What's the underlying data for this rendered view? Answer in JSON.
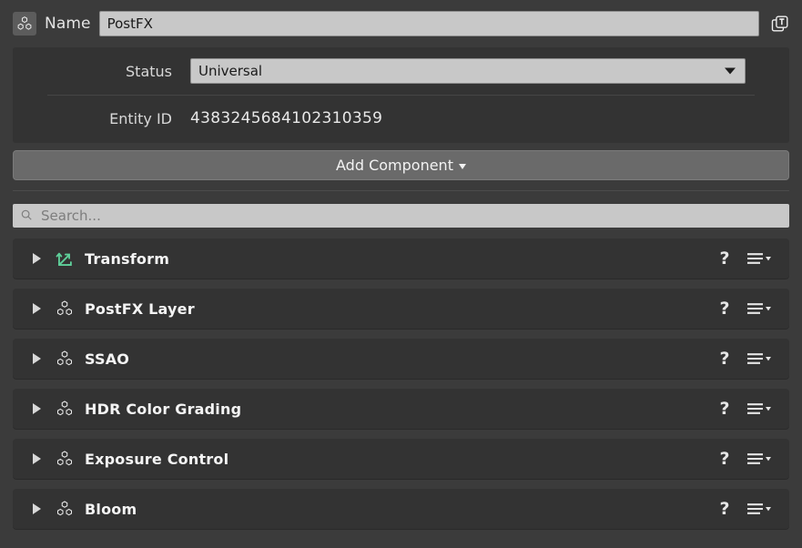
{
  "header": {
    "entity_icon": "cubes-icon",
    "name_label": "Name",
    "name_value": "PostFX",
    "name_placeholder": "Name",
    "save_icon": "save-to-library-icon"
  },
  "info": {
    "status_label": "Status",
    "status_value": "Universal",
    "status_caret_icon": "chevron-down-icon",
    "entity_id_label": "Entity ID",
    "entity_id_value": "4383245684102310359"
  },
  "toolbar": {
    "add_component_label": "Add Component",
    "add_component_caret_icon": "caret-down-icon"
  },
  "search": {
    "icon": "search-icon",
    "value": "",
    "placeholder": "Search..."
  },
  "components": [
    {
      "name": "Transform",
      "icon": "transform-axes-icon",
      "help": "?",
      "menu_icon": "hamburger-menu-icon"
    },
    {
      "name": "PostFX Layer",
      "icon": "cubes-icon",
      "help": "?",
      "menu_icon": "hamburger-menu-icon"
    },
    {
      "name": "SSAO",
      "icon": "cubes-icon",
      "help": "?",
      "menu_icon": "hamburger-menu-icon"
    },
    {
      "name": "HDR Color Grading",
      "icon": "cubes-icon",
      "help": "?",
      "menu_icon": "hamburger-menu-icon"
    },
    {
      "name": "Exposure Control",
      "icon": "cubes-icon",
      "help": "?",
      "menu_icon": "hamburger-menu-icon"
    },
    {
      "name": "Bloom",
      "icon": "cubes-icon",
      "help": "?",
      "menu_icon": "hamburger-menu-icon"
    }
  ],
  "colors": {
    "background": "#3b3b3b",
    "panel": "#333333",
    "field_light": "#c8c8c8",
    "button": "#6a6a6a",
    "text": "#f2f2f2",
    "accent_green": "#5fcf9a"
  }
}
